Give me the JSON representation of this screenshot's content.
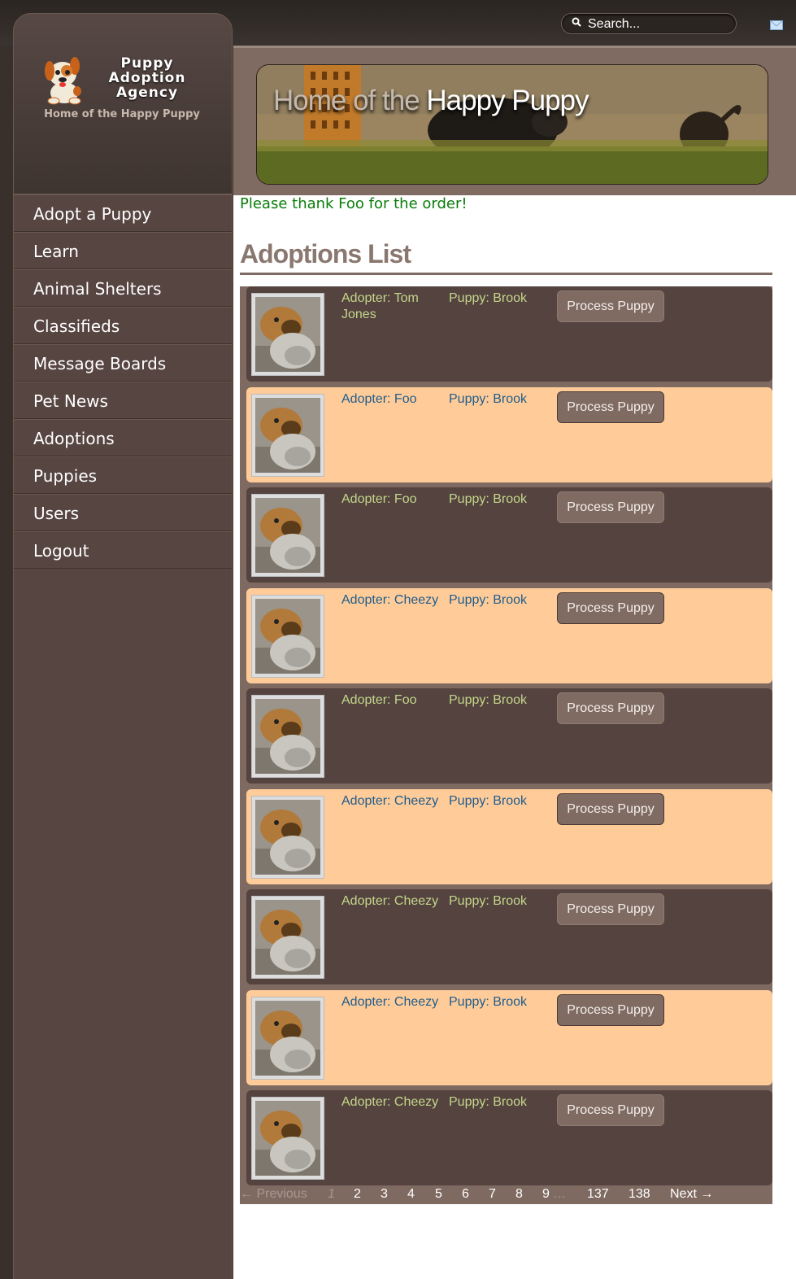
{
  "topbar": {
    "search_placeholder": "Search...",
    "icons": [
      "search-icon",
      "mail-icon"
    ]
  },
  "brand": {
    "name": "Puppy Adoption Agency",
    "name_lines": [
      "Puppy",
      "Adoption",
      "Agency"
    ],
    "tagline": "Home of the Happy Puppy"
  },
  "nav": [
    {
      "label": "Adopt a Puppy"
    },
    {
      "label": "Learn"
    },
    {
      "label": "Animal Shelters"
    },
    {
      "label": "Classifieds"
    },
    {
      "label": "Message Boards"
    },
    {
      "label": "Pet News"
    },
    {
      "label": "Adoptions"
    },
    {
      "label": "Puppies"
    },
    {
      "label": "Users"
    },
    {
      "label": "Logout"
    }
  ],
  "banner": {
    "title_part1": "Home of the ",
    "title_part2": "Happy Puppy"
  },
  "flash": "Please thank Foo for the order!",
  "list_title": "Adoptions List",
  "button_label": "Process Puppy",
  "adoptions": [
    {
      "adopter": "Adopter: Tom Jones",
      "puppy": "Puppy: Brook",
      "style": "dark"
    },
    {
      "adopter": "Adopter: Foo",
      "puppy": "Puppy: Brook",
      "style": "light"
    },
    {
      "adopter": "Adopter: Foo",
      "puppy": "Puppy: Brook",
      "style": "dark"
    },
    {
      "adopter": "Adopter: Cheezy",
      "puppy": "Puppy: Brook",
      "style": "light"
    },
    {
      "adopter": "Adopter: Foo",
      "puppy": "Puppy: Brook",
      "style": "dark"
    },
    {
      "adopter": "Adopter: Cheezy",
      "puppy": "Puppy: Brook",
      "style": "light"
    },
    {
      "adopter": "Adopter: Cheezy",
      "puppy": "Puppy: Brook",
      "style": "dark"
    },
    {
      "adopter": "Adopter: Cheezy",
      "puppy": "Puppy: Brook",
      "style": "light"
    },
    {
      "adopter": "Adopter: Cheezy",
      "puppy": "Puppy: Brook",
      "style": "dark"
    }
  ],
  "pagination": {
    "previous": "← Previous",
    "current": "1",
    "pages": [
      "2",
      "3",
      "4",
      "5",
      "6",
      "7",
      "8",
      "9"
    ],
    "ellipsis": "…",
    "tail_pages": [
      "137",
      "138"
    ],
    "next": "Next →"
  },
  "colors": {
    "row_dark": "#554340",
    "row_light": "#ffcc99",
    "flash_green": "#0a7d0a",
    "sidebar": "#564540"
  }
}
